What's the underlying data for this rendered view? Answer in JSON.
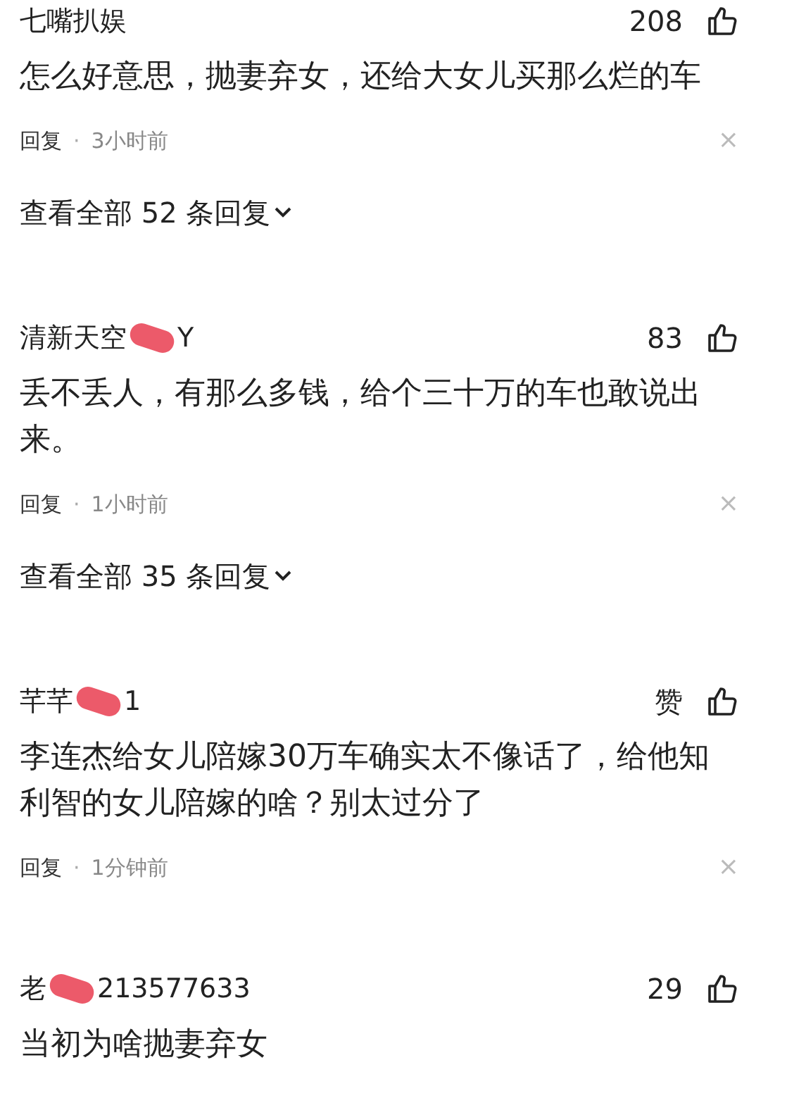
{
  "comments": [
    {
      "name": [
        {
          "kind": "text",
          "text": "七嘴扒娱"
        }
      ],
      "likes": "208",
      "body": "怎么好意思，抛妻弃女，还给大女儿买那么烂的车",
      "reply_label": "回复",
      "separator": "·",
      "time": "3小时前",
      "dismiss": "×",
      "view_all": "查看全部 52 条回复"
    },
    {
      "name": [
        {
          "kind": "text",
          "text": "清新天空"
        },
        {
          "kind": "redaction"
        },
        {
          "kind": "text",
          "text": "Y"
        }
      ],
      "likes": "83",
      "body": "丢不丢人，有那么多钱，给个三十万的车也敢说出来。",
      "reply_label": "回复",
      "separator": "·",
      "time": "1小时前",
      "dismiss": "×",
      "view_all": "查看全部 35 条回复"
    },
    {
      "name": [
        {
          "kind": "text",
          "text": "芊芊"
        },
        {
          "kind": "redaction"
        },
        {
          "kind": "text",
          "text": "1"
        }
      ],
      "likes": "赞",
      "body": "李连杰给女儿陪嫁30万车确实太不像话了，给他知利智的女儿陪嫁的啥？别太过分了",
      "reply_label": "回复",
      "separator": "·",
      "time": "1分钟前",
      "dismiss": "×"
    },
    {
      "name": [
        {
          "kind": "text",
          "text": "老"
        },
        {
          "kind": "redaction"
        },
        {
          "kind": "text",
          "text": "213577633"
        }
      ],
      "likes": "29",
      "body": "当初为啥抛妻弃女"
    }
  ]
}
